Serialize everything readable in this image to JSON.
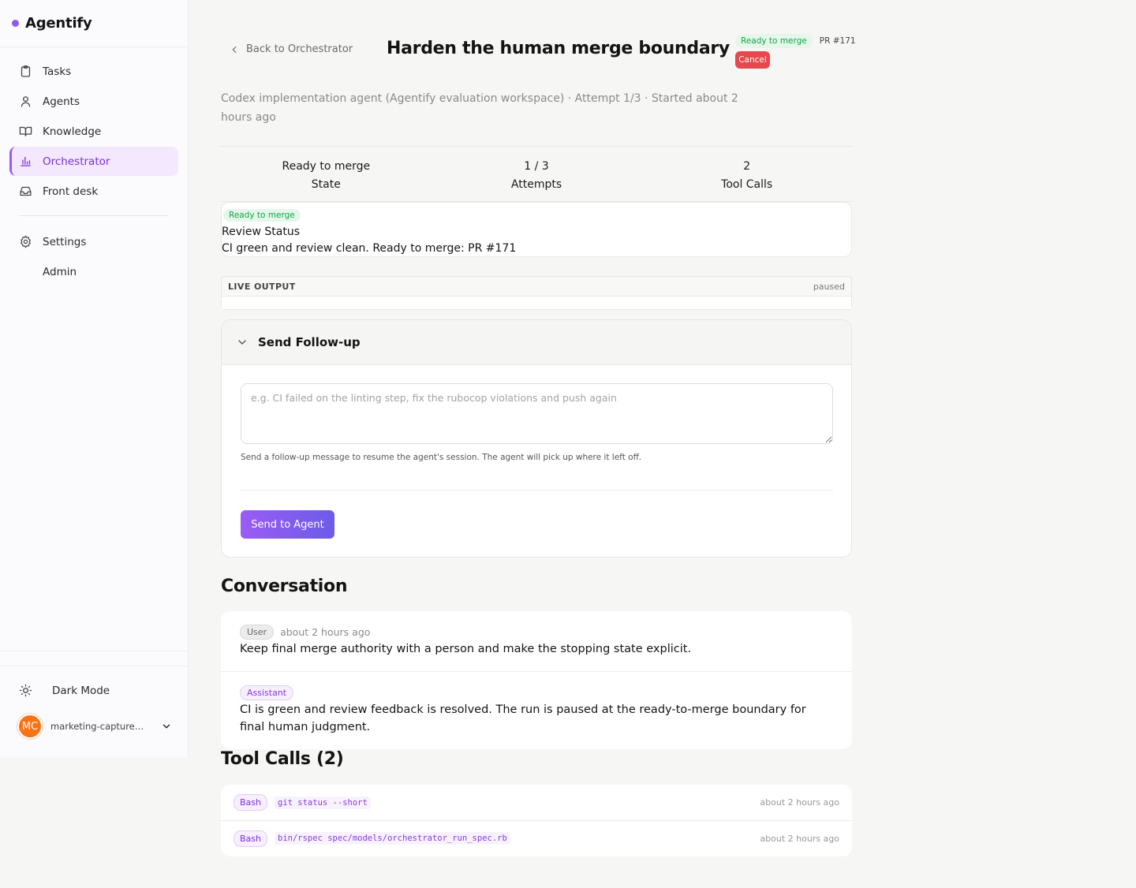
{
  "brand": {
    "name": "Agentify",
    "accent": "#8b5cf6"
  },
  "sidebar": {
    "items": [
      {
        "label": "Tasks",
        "icon": "clipboard-icon"
      },
      {
        "label": "Agents",
        "icon": "user-icon"
      },
      {
        "label": "Knowledge",
        "icon": "book-icon"
      },
      {
        "label": "Orchestrator",
        "icon": "bar-chart-icon",
        "active": true
      },
      {
        "label": "Front desk",
        "icon": "inbox-icon"
      }
    ],
    "settings": {
      "label": "Settings",
      "icon": "gear-icon"
    },
    "admin": {
      "label": "Admin"
    },
    "dark_mode": {
      "label": "Dark Mode",
      "icon": "sun-icon"
    },
    "user": {
      "initials": "MC",
      "email": "marketing-capture@agentify.dev",
      "avatar_color": "#f97316"
    }
  },
  "header": {
    "back_label": "Back to Orchestrator",
    "title": "Harden the human merge boundary",
    "status_badge": "Ready to merge",
    "pr": "PR #171",
    "cancel_label": "Cancel",
    "subtitle": "Codex implementation agent (Agentify evaluation workspace) · Attempt 1/3 · Started about 2 hours ago"
  },
  "stats": [
    {
      "value": "Ready to merge",
      "label": "State"
    },
    {
      "value": "1 / 3",
      "label": "Attempts"
    },
    {
      "value": "2",
      "label": "Tool Calls"
    }
  ],
  "review": {
    "badge": "Ready to merge",
    "title": "Review Status",
    "text": "CI green and review clean. Ready to merge: PR #171"
  },
  "live_output": {
    "title": "LIVE OUTPUT",
    "status": "paused"
  },
  "followup": {
    "title": "Send Follow-up",
    "placeholder": "e.g. CI failed on the linting step, fix the rubocop violations and push again",
    "value": "",
    "help": "Send a follow-up message to resume the agent's session. The agent will pick up where it left off.",
    "send_label": "Send to Agent"
  },
  "conversation": {
    "title": "Conversation",
    "messages": [
      {
        "role": "User",
        "time": "about 2 hours ago",
        "text": "Keep final merge authority with a person and make the stopping state explicit."
      },
      {
        "role": "Assistant",
        "time": "",
        "text": "CI is green and review feedback is resolved. The run is paused at the ready-to-merge boundary for final human judgment."
      }
    ]
  },
  "tool_calls": {
    "title": "Tool Calls (2)",
    "items": [
      {
        "tool": "Bash",
        "command": "git status --short",
        "time": "about 2 hours ago"
      },
      {
        "tool": "Bash",
        "command": "bin/rspec spec/models/orchestrator_run_spec.rb",
        "time": "about 2 hours ago"
      }
    ]
  }
}
